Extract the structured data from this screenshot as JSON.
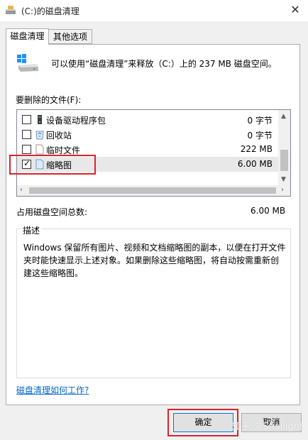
{
  "window": {
    "title": "(C:)的磁盘清理",
    "close_glyph": "✕"
  },
  "tabs": [
    {
      "label": "磁盘清理",
      "active": true
    },
    {
      "label": "其他选项",
      "active": false
    }
  ],
  "intro_text": "可以使用“磁盘清理”来释放（C:）上的 237 MB 磁盘空间。",
  "files_label": "要删除的文件(F):",
  "files": [
    {
      "name": "设备驱动程序包",
      "size": "0 字节",
      "checked": false,
      "icon": "driver-package-icon"
    },
    {
      "name": "回收站",
      "size": "0 字节",
      "checked": false,
      "icon": "recycle-bin-icon"
    },
    {
      "name": "临时文件",
      "size": "222 MB",
      "checked": false,
      "icon": "file-icon"
    },
    {
      "name": "缩略图",
      "size": "6.00 MB",
      "checked": true,
      "icon": "file-icon"
    }
  ],
  "total": {
    "label": "占用磁盘空间总数:",
    "value": "6.00 MB"
  },
  "description": {
    "legend": "描述",
    "text": "Windows 保留所有图片、视频和文档缩略图的副本，以便在打开文件夹时能快速显示上述对象。如果删除这些缩略图，将自动按需重新创建这些缩略图。"
  },
  "help_link": "磁盘清理如何工作?",
  "buttons": {
    "ok": "确定",
    "cancel": "取消"
  },
  "watermark": "知乎 @Snailight",
  "colors": {
    "highlight": "#d9232e",
    "link": "#0066cc",
    "accent": "#0078d7"
  }
}
